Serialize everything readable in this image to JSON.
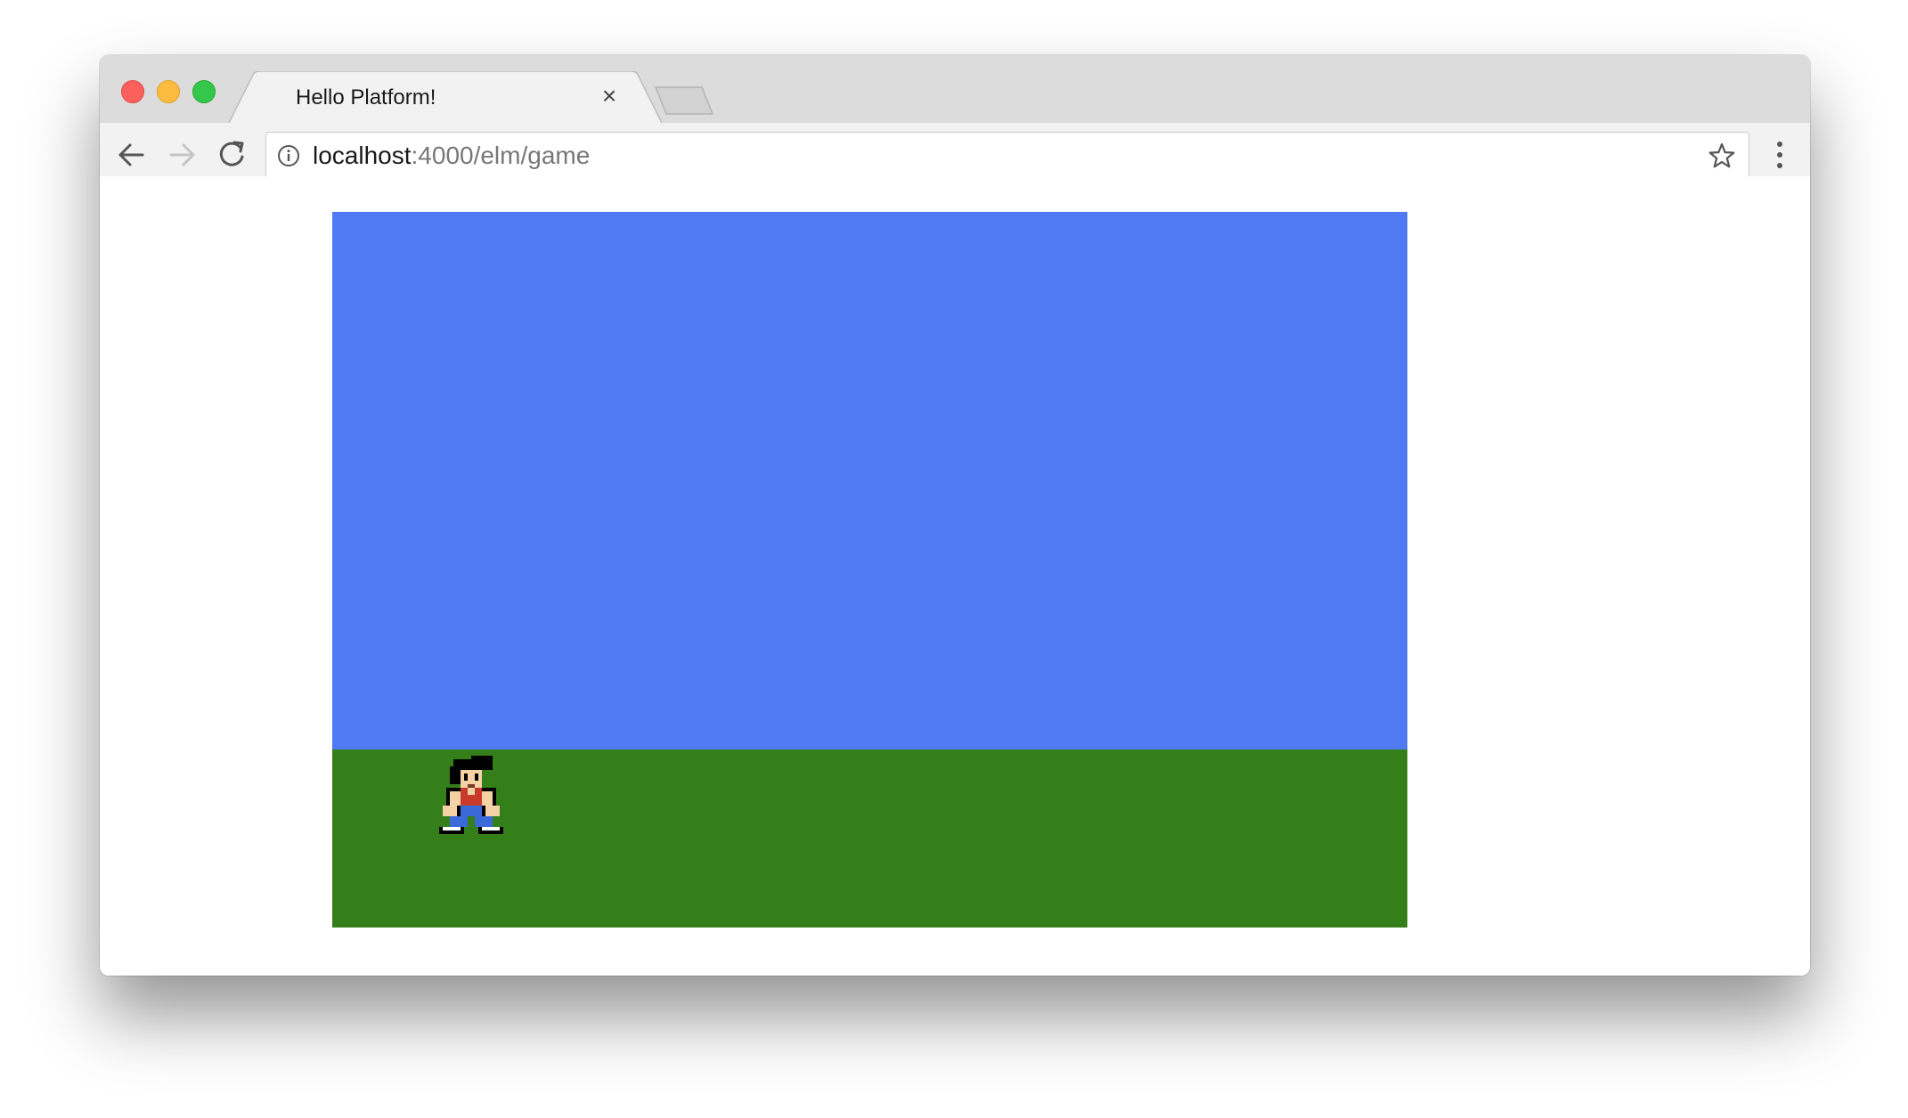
{
  "browser": {
    "tab": {
      "title": "Hello Platform!",
      "close_glyph": "×"
    },
    "address": {
      "host": "localhost",
      "path": ":4000/elm/game"
    },
    "icons": {
      "back": "arrow-left-icon",
      "forward": "arrow-right-icon",
      "reload": "reload-icon",
      "site_info": "info-icon",
      "bookmark": "star-icon",
      "menu": "kebab-menu-icon"
    }
  },
  "game": {
    "colors": {
      "sky": "#4f7af3",
      "ground": "#357f1a"
    },
    "player": {
      "sprite": "pixel-hero-standing"
    }
  }
}
